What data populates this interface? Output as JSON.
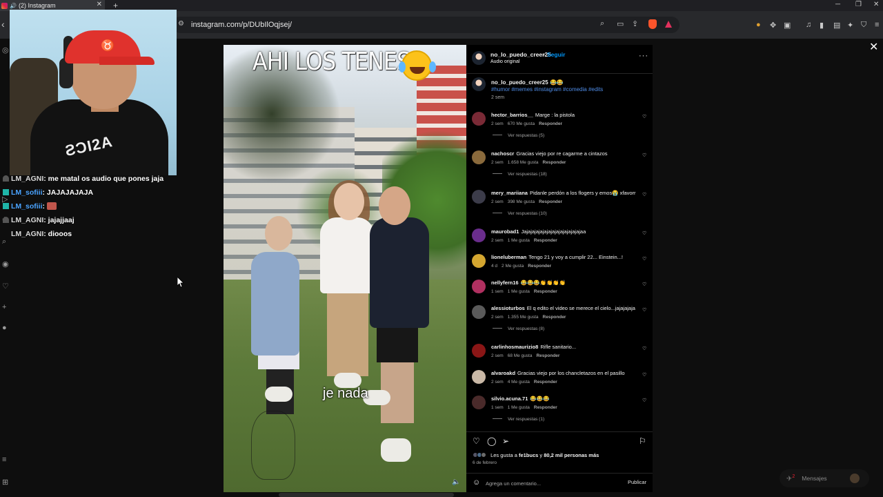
{
  "browser": {
    "tab_title": "(2) Instagram",
    "tab_close": "✕",
    "new_tab": "+",
    "url": "instagram.com/p/DUbIlOqjsej/",
    "win_min": "─",
    "win_max": "❐",
    "win_close": "✕"
  },
  "chat": [
    {
      "user": "LM_AGNI",
      "message": ": me matal os audio que pones jaja",
      "color": "#d8d8d8",
      "badge": "none"
    },
    {
      "user": "LM_sofiii",
      "message": ": JAJAJAJAJA",
      "color": "#4aa3ff",
      "badge": "teal"
    },
    {
      "user": "LM_sofiii",
      "message": ": ",
      "color": "#4aa3ff",
      "badge": "teal",
      "emote": true
    },
    {
      "user": "LM_AGNI",
      "message": ": jajajjaaj",
      "color": "#d8d8d8",
      "badge": "none"
    },
    {
      "user": "LM_AGNI",
      "message": ": diooos",
      "color": "#d8d8d8",
      "badge": "none"
    }
  ],
  "video": {
    "title_text": "AHI LOS TENES",
    "subtitle": "je nada"
  },
  "post": {
    "username": "no_lo_puedo_creer25",
    "dot": "•",
    "follow": "Seguir",
    "audio": "Audio original",
    "caption_user": "no_lo_puedo_creer25",
    "caption_emoji": "😂😂",
    "hashtags": "#humor #memes #instagram #comedia #edits",
    "caption_time": "2 sem",
    "likes_prefix": "Les gusta a ",
    "likes_user": "fe1bucs",
    "likes_mid": " y ",
    "likes_count": "80,2 mil personas más",
    "date": "6 de febrero",
    "comment_placeholder": "Agrega un comentario...",
    "publish": "Publicar"
  },
  "comments": [
    {
      "user": "hector_barrios__",
      "text": "Marge : la pistola",
      "time": "2 sem",
      "likes": "670 Me gusta",
      "reply": "Responder",
      "replies": "Ver respuestas (5)",
      "avatar": "#7a2a36"
    },
    {
      "user": "nachoscr",
      "text": "Gracias viejo por re cagarme a cintazos",
      "time": "2 sem",
      "likes": "1.658 Me gusta",
      "reply": "Responder",
      "replies": "Ver respuestas (18)",
      "avatar": "#8a6a3c"
    },
    {
      "user": "mery_mariiana",
      "text": "Pidanle perdón a los flogers y emos😭 xfavorr",
      "time": "2 sem",
      "likes": "398 Me gusta",
      "reply": "Responder",
      "replies": "Ver respuestas (10)",
      "avatar": "#3c3c4a"
    },
    {
      "user": "maurobad1",
      "text": "Jajajajajajajajajajajajajajajaa",
      "time": "2 sem",
      "likes": "1 Me gusta",
      "reply": "Responder",
      "replies": "",
      "avatar": "#6a2d8c"
    },
    {
      "user": "lioneluberman",
      "text": "Tengo 21 y voy a cumplir 22... Einstein...!",
      "time": "4 d",
      "likes": "2 Me gusta",
      "reply": "Responder",
      "replies": "",
      "avatar": "#d4a630"
    },
    {
      "user": "nellyfern16",
      "text": "😂😂😂👏👏👏👏",
      "time": "1 sem",
      "likes": "1 Me gusta",
      "reply": "Responder",
      "replies": "",
      "avatar": "#b03060"
    },
    {
      "user": "alessioturbos",
      "text": "El q edito el video se merece el cielo...jajajajaja",
      "time": "2 sem",
      "likes": "1.355 Me gusta",
      "reply": "Responder",
      "replies": "Ver respuestas (8)",
      "avatar": "#5a5a5a"
    },
    {
      "user": "carlinhosmaurizio8",
      "text": "Rifle sanitario...",
      "time": "2 sem",
      "likes": "68 Me gusta",
      "reply": "Responder",
      "replies": "",
      "avatar": "#8a1616"
    },
    {
      "user": "alvaroakd",
      "text": "Gracias viejo por los chancletazos en el pasillo",
      "time": "2 sem",
      "likes": "4 Me gusta",
      "reply": "Responder",
      "replies": "",
      "avatar": "#c9b8a6"
    },
    {
      "user": "silvio.acuna.71",
      "text": "😂😂😂",
      "time": "1 sem",
      "likes": "1 Me gusta",
      "reply": "Responder",
      "replies": "Ver respuestas (1)",
      "avatar": "#4a2a2a"
    }
  ],
  "sidebar": {
    "messages": "Mensajes",
    "messages_badge": "2"
  }
}
